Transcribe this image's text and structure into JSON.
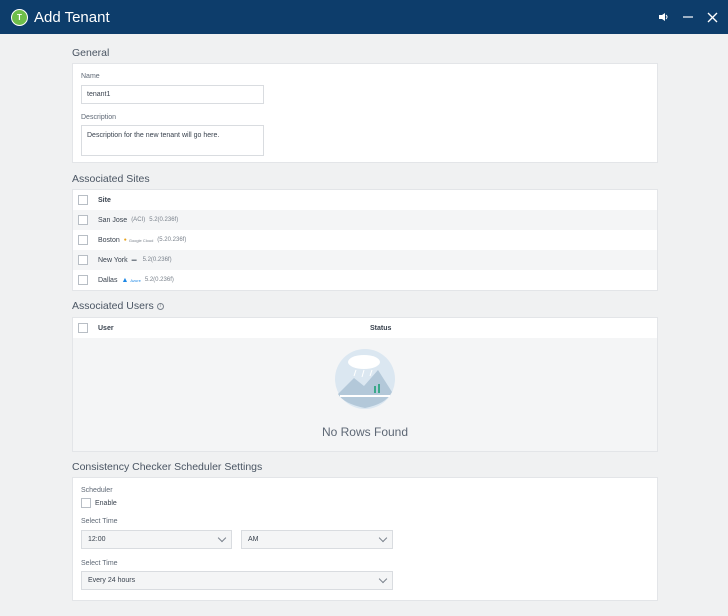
{
  "window": {
    "title": "Add Tenant",
    "icon_letter": "T"
  },
  "general": {
    "section_title": "General",
    "name_label": "Name",
    "name_value": "tenant1",
    "description_label": "Description",
    "description_value": "Description for the new tenant will go here."
  },
  "sites": {
    "section_title": "Associated Sites",
    "header": "Site",
    "rows": [
      {
        "name": "San Jose",
        "tag": "(ACI)",
        "version": "5.2(0.236f)"
      },
      {
        "name": "Boston",
        "tag": "Google Cloud",
        "version": "(5.20.236f)"
      },
      {
        "name": "New York",
        "tag": "",
        "version": "5.2(0.236f)"
      },
      {
        "name": "Dallas",
        "tag": "Azure",
        "version": "5.2(0.236f)"
      }
    ]
  },
  "users": {
    "section_title": "Associated Users",
    "col_user": "User",
    "col_status": "Status",
    "empty_text": "No Rows Found"
  },
  "scheduler": {
    "section_title": "Consistency Checker Scheduler Settings",
    "scheduler_label": "Scheduler",
    "enable_label": "Enable",
    "time_label": "Select Time",
    "time_value": "12:00",
    "ampm_value": "AM",
    "interval_label": "Select Time",
    "interval_value": "Every 24 hours"
  },
  "colors": {
    "titlebar": "#0d3d6b",
    "icon": "#6ebe4a"
  }
}
